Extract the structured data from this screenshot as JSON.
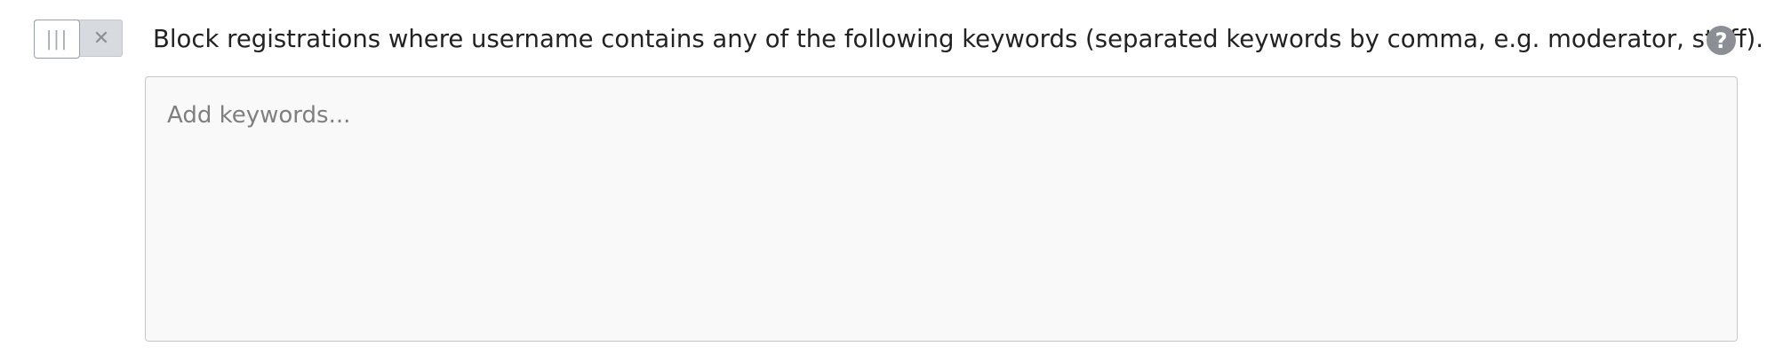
{
  "setting": {
    "toggle": {
      "state": "off",
      "handle_glyph": "|||",
      "off_glyph": "✕",
      "handle_icon": "grip-lines-icon",
      "off_icon": "close-icon"
    },
    "label": "Block registrations where username contains any of the following keywords (separated keywords by comma, e.g. moderator, staff).",
    "help": {
      "glyph": "?",
      "icon": "question-circle-icon"
    },
    "keywords": {
      "value": "",
      "placeholder": "Add keywords..."
    }
  },
  "colors": {
    "toggle_track": "#d7dadf",
    "toggle_border": "#9ba1a8",
    "help_icon_bg": "#8b8e92",
    "textarea_bg": "#f9f9f9",
    "textarea_border": "#c6c6c6",
    "label_text": "#222222",
    "placeholder_text": "#7f7f7f"
  }
}
